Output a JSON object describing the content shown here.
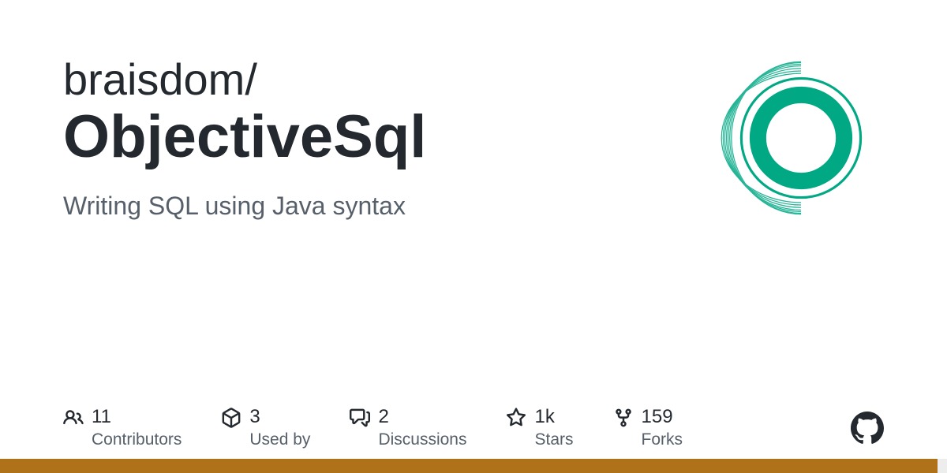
{
  "repo": {
    "owner": "braisdom/",
    "name": "ObjectiveSql",
    "description": "Writing SQL using Java syntax"
  },
  "stats": {
    "contributors": {
      "value": "11",
      "label": "Contributors"
    },
    "usedby": {
      "value": "3",
      "label": "Used by"
    },
    "discussions": {
      "value": "2",
      "label": "Discussions"
    },
    "stars": {
      "value": "1k",
      "label": "Stars"
    },
    "forks": {
      "value": "159",
      "label": "Forks"
    }
  },
  "languages": [
    {
      "color": "#b07219",
      "percent": 99
    },
    {
      "color": "#ededed",
      "percent": 1
    }
  ],
  "logo": {
    "accent": "#00a884"
  }
}
